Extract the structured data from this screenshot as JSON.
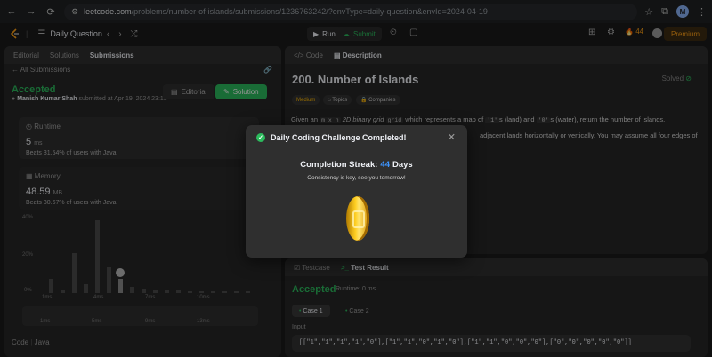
{
  "browser": {
    "host": "leetcode.com",
    "path": "/problems/number-of-islands/submissions/1236763242/?envType=daily-question&envId=2024-04-19",
    "profile_initial": "M"
  },
  "topbar": {
    "title": "Daily Question",
    "run_label": "Run",
    "submit_label": "Submit",
    "streak": "44",
    "premium_label": "Premium"
  },
  "left": {
    "tabs": [
      "Editorial",
      "Solutions",
      "Submissions"
    ],
    "all_submissions": "All Submissions",
    "status": "Accepted",
    "user": "Manish Kumar Shah",
    "submitted": "submitted at Apr 19, 2024 23:18",
    "editorial_btn": "Editorial",
    "solution_btn": "Solution",
    "runtime_label": "Runtime",
    "runtime_value": "5",
    "runtime_unit": "ms",
    "runtime_beats": "Beats 31.54% of users with Java",
    "memory_label": "Memory",
    "memory_value": "48.59",
    "memory_unit": "MB",
    "memory_beats": "Beats 30.67% of users with Java",
    "y_ticks": [
      "40%",
      "20%",
      "0%"
    ],
    "x_ticks": [
      "1ms",
      "4ms",
      "7ms",
      "10ms"
    ],
    "x_ticks2": [
      "1ms",
      "5ms",
      "9ms",
      "13ms"
    ],
    "code_label": "Code",
    "lang": "Java",
    "bars": [
      0.2,
      0.05,
      0.55,
      0.12,
      1.0,
      0.35,
      0.2,
      0.08,
      0.06,
      0.05,
      0.04,
      0.04,
      0.03,
      0.03,
      0.03,
      0.02,
      0.02,
      0.02
    ]
  },
  "description": {
    "tabs": [
      "Code",
      "Description"
    ],
    "title": "200. Number of Islands",
    "status": "Solved",
    "chips": [
      "Medium",
      "Topics",
      "Companies"
    ],
    "line1_pre": "Given an",
    "line1_code1": "m x n",
    "line1_mid": "2D binary grid",
    "line1_code2": "grid",
    "line1_post": "which represents a map of",
    "line1_code3": "'1'",
    "line1_post2": "s (land) and",
    "line1_code4": "'0'",
    "line1_post3": "s (water), return the number of islands.",
    "line2": "adjacent lands horizontally or vertically. You may assume all four edges of the"
  },
  "result": {
    "tabs": [
      "Testcase",
      "Test Result"
    ],
    "status": "Accepted",
    "runtime": "Runtime: 0 ms",
    "cases": [
      "Case 1",
      "Case 2"
    ],
    "input_label": "Input",
    "input_value": "[[\"1\",\"1\",\"1\",\"1\",\"0\"],[\"1\",\"1\",\"0\",\"1\",\"0\"],[\"1\",\"1\",\"0\",\"0\",\"0\"],[\"0\",\"0\",\"0\",\"0\",\"0\"]]"
  },
  "modal": {
    "title": "Daily Coding Challenge Completed!",
    "streak_pre": "Completion Streak:",
    "streak_num": "44",
    "streak_post": "Days",
    "subtitle": "Consistency is key, see you tomorrow!"
  }
}
